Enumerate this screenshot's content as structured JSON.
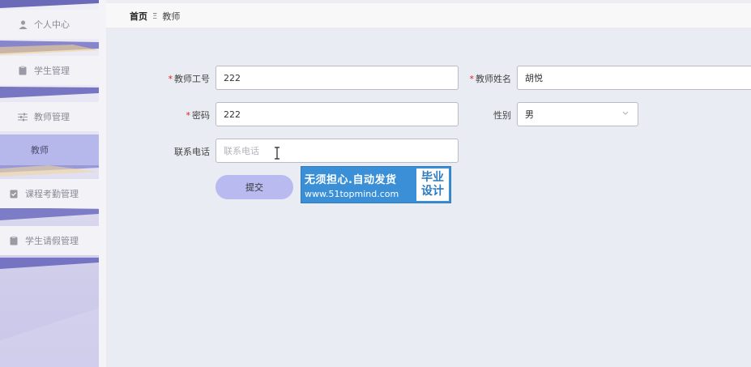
{
  "sidebar": {
    "items": [
      {
        "label": "个人中心",
        "icon": "user-icon"
      },
      {
        "label": "学生管理",
        "icon": "clipboard-icon"
      },
      {
        "label": "教师管理",
        "icon": "sliders-icon"
      },
      {
        "label": "教师",
        "icon": ""
      },
      {
        "label": "课程考勤管理",
        "icon": "clipboard-check-icon"
      },
      {
        "label": "学生请假管理",
        "icon": "clipboard-icon"
      }
    ]
  },
  "breadcrumb": {
    "home": "首页",
    "separator": "Ξ",
    "current": "教师"
  },
  "form": {
    "teacher_id": {
      "label": "教师工号",
      "value": "222",
      "required": true
    },
    "teacher_name": {
      "label": "教师姓名",
      "value": "胡悦",
      "required": true
    },
    "password": {
      "label": "密码",
      "value": "222",
      "required": true
    },
    "gender": {
      "label": "性别",
      "value": "男"
    },
    "phone": {
      "label": "联系电话",
      "value": "",
      "placeholder": "联系电话"
    },
    "submit_label": "提交"
  },
  "promo": {
    "line1": "无须担心.自动发货",
    "line2": "www.51topmind.com",
    "badge_line1": "毕业",
    "badge_line2": "设计"
  },
  "colors": {
    "accent": "#b8baf0",
    "active_menu": "#b6b8ec",
    "promo_blue": "#3a8fd6"
  }
}
